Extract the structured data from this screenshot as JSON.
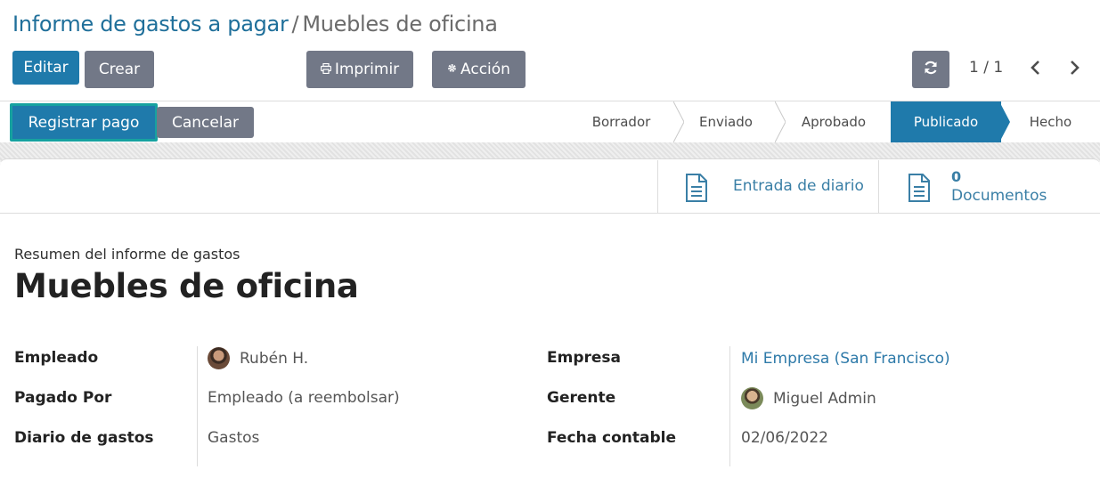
{
  "breadcrumb": {
    "parent": "Informe de gastos a pagar",
    "separator": "/",
    "current": "Muebles de oficina"
  },
  "toolbar": {
    "edit_label": "Editar",
    "create_label": "Crear",
    "print_label": "Imprimir",
    "action_label": "Acción"
  },
  "pager": {
    "value": "1 / 1"
  },
  "statusbar": {
    "register_label": "Registrar pago",
    "cancel_label": "Cancelar",
    "stages": [
      "Borrador",
      "Enviado",
      "Aprobado",
      "Publicado",
      "Hecho"
    ],
    "active_stage": "Publicado"
  },
  "smart_buttons": {
    "journal_entry": {
      "label": "Entrada de diario"
    },
    "documents": {
      "count": "0",
      "label": "Documentos"
    }
  },
  "form": {
    "subtitle": "Resumen del informe de gastos",
    "title": "Muebles de oficina",
    "left": [
      {
        "label": "Empleado",
        "value": "Rubén H."
      },
      {
        "label": "Pagado Por",
        "value": "Empleado (a reembolsar)"
      },
      {
        "label": "Diario de gastos",
        "value": "Gastos"
      }
    ],
    "right": [
      {
        "label": "Empresa",
        "value": "Mi Empresa (San Francisco)"
      },
      {
        "label": "Gerente",
        "value": "Miguel Admin"
      },
      {
        "label": "Fecha contable",
        "value": "02/06/2022"
      }
    ]
  },
  "colors": {
    "primary": "#1f7aab",
    "secondary": "#727887",
    "highlight": "#17a2a0"
  }
}
